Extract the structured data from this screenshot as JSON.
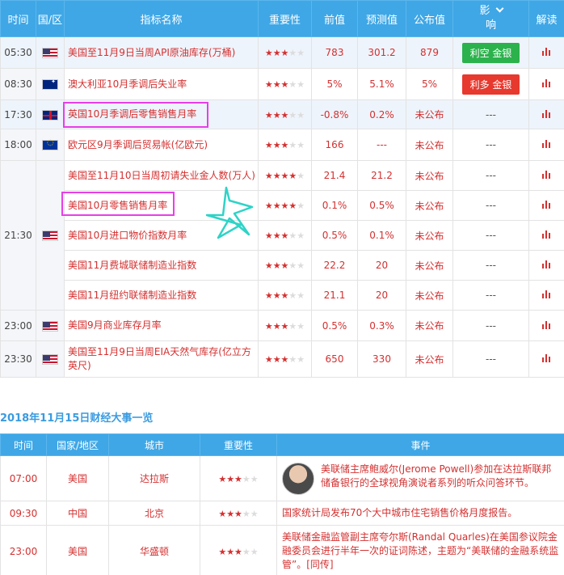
{
  "calendar": {
    "headers": {
      "time": "时间",
      "region": "国/区",
      "indicator": "指标名称",
      "importance": "重要性",
      "previous": "前值",
      "forecast": "预测值",
      "actual": "公布值",
      "impact_top": "影",
      "impact_bottom": "响",
      "interpret": "解读"
    },
    "rows": [
      {
        "time": "05:30",
        "flag": "us",
        "name": "美国至11月9日当周API原油库存(万桶)",
        "stars": 3,
        "prev": "783",
        "forecast": "301.2",
        "actual": "879",
        "impact": "利空 金银"
      },
      {
        "time": "08:30",
        "flag": "au",
        "name": "澳大利亚10月季调后失业率",
        "stars": 3,
        "prev": "5%",
        "forecast": "5.1%",
        "actual": "5%",
        "impact": "利多 金银"
      },
      {
        "time": "17:30",
        "flag": "uk",
        "name": "英国10月季调后零售销售月率",
        "stars": 3,
        "prev": "-0.8%",
        "forecast": "0.2%",
        "actual": "未公布",
        "impact": "---"
      },
      {
        "time": "18:00",
        "flag": "eu",
        "name": "欧元区9月季调后贸易帐(亿欧元)",
        "stars": 3,
        "prev": "166",
        "forecast": "---",
        "actual": "未公布",
        "impact": "---"
      },
      {
        "time": "21:30",
        "flag": "us",
        "name": "美国至11月10日当周初请失业金人数(万人)",
        "stars": 4,
        "prev": "21.4",
        "forecast": "21.2",
        "actual": "未公布",
        "impact": "---"
      },
      {
        "time": "",
        "flag": "",
        "name": "美国10月零售销售月率",
        "stars": 4,
        "prev": "0.1%",
        "forecast": "0.5%",
        "actual": "未公布",
        "impact": "---"
      },
      {
        "time": "",
        "flag": "",
        "name": "美国10月进口物价指数月率",
        "stars": 3,
        "prev": "0.5%",
        "forecast": "0.1%",
        "actual": "未公布",
        "impact": "---"
      },
      {
        "time": "",
        "flag": "",
        "name": "美国11月费城联储制造业指数",
        "stars": 3,
        "prev": "22.2",
        "forecast": "20",
        "actual": "未公布",
        "impact": "---"
      },
      {
        "time": "",
        "flag": "",
        "name": "美国11月纽约联储制造业指数",
        "stars": 3,
        "prev": "21.1",
        "forecast": "20",
        "actual": "未公布",
        "impact": "---"
      },
      {
        "time": "23:00",
        "flag": "us",
        "name": "美国9月商业库存月率",
        "stars": 3,
        "prev": "0.5%",
        "forecast": "0.3%",
        "actual": "未公布",
        "impact": "---"
      },
      {
        "time": "23:30",
        "flag": "us",
        "name": "美国至11月9日当周EIA天然气库存(亿立方英尺)",
        "stars": 3,
        "prev": "650",
        "forecast": "330",
        "actual": "未公布",
        "impact": "---"
      }
    ]
  },
  "section_title": "2018年11月15日财经大事一览",
  "events": {
    "headers": {
      "time": "时间",
      "country": "国家/地区",
      "city": "城市",
      "importance": "重要性",
      "event": "事件"
    },
    "rows": [
      {
        "time": "07:00",
        "country": "美国",
        "city": "达拉斯",
        "stars": 3,
        "event": "美联储主席鲍威尔(Jerome Powell)参加在达拉斯联邦储备银行的全球视角演说者系列的听众问答环节。"
      },
      {
        "time": "09:30",
        "country": "中国",
        "city": "北京",
        "stars": 3,
        "event": "国家统计局发布70个大中城市住宅销售价格月度报告。"
      },
      {
        "time": "23:00",
        "country": "美国",
        "city": "华盛顿",
        "stars": 3,
        "event": "美联储金融监管副主席夸尔斯(Randal Quarles)在美国参议院金融委员会进行半年一次的证词陈述，主题为“美联储的金融系统监管”。[同传]"
      }
    ]
  },
  "colors": {
    "header_bg": "#3fa7e6",
    "red_text": "#d43030",
    "badge_bearish": "#2bb24c",
    "badge_bullish": "#e7392e",
    "highlight": "#e83ee8"
  }
}
